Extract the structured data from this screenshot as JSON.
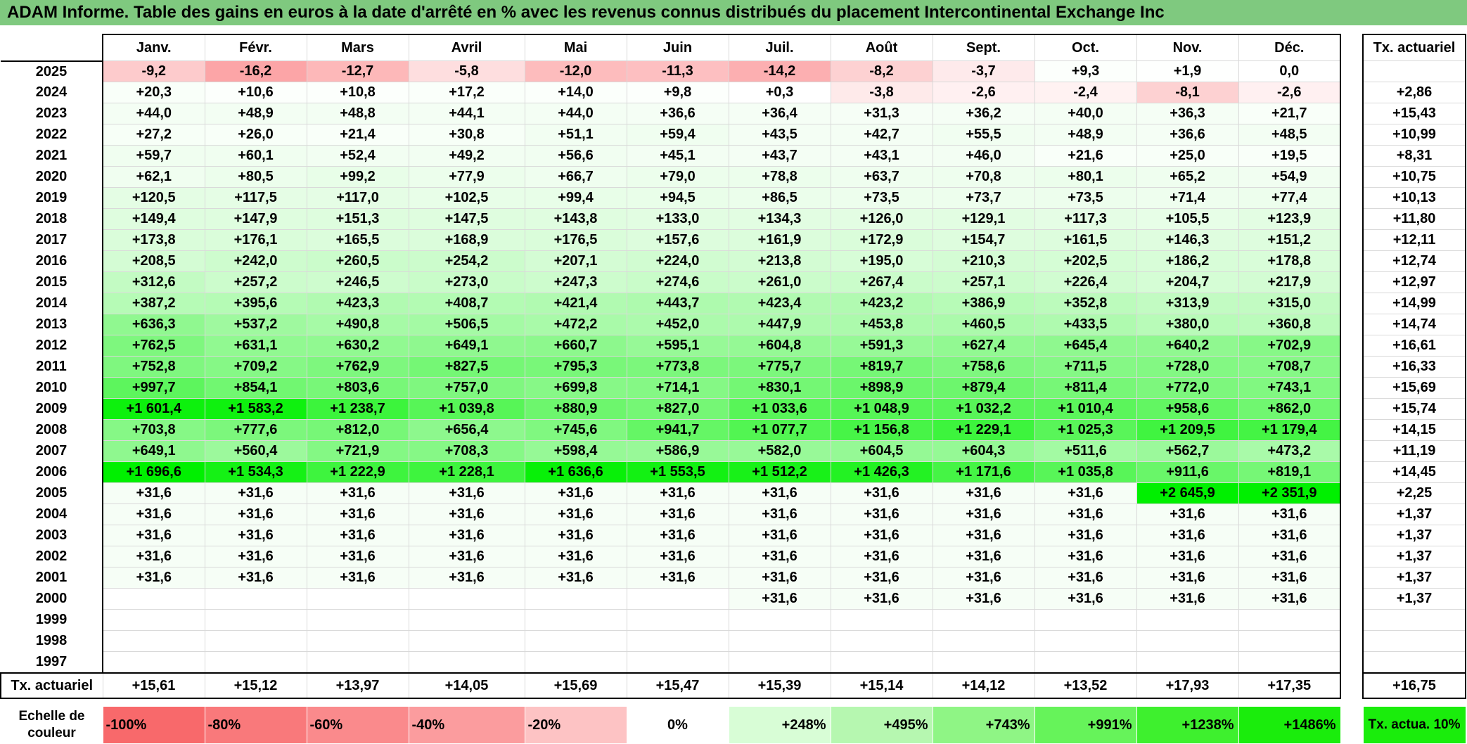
{
  "title": "ADAM Informe. Table des gains en euros à la date d'arrêté en % avec les revenus connus distribués du placement Intercontinental Exchange Inc",
  "months": [
    "Janv.",
    "Févr.",
    "Mars",
    "Avril",
    "Mai",
    "Juin",
    "Juil.",
    "Août",
    "Sept.",
    "Oct.",
    "Nov.",
    "Déc."
  ],
  "rate_header": "Tx. actuariel",
  "rows": [
    {
      "year": "2025",
      "values": [
        "-9,2",
        "-16,2",
        "-12,7",
        "-5,8",
        "-12,0",
        "-11,3",
        "-14,2",
        "-8,2",
        "-3,7",
        "+9,3",
        "+1,9",
        "0,0"
      ],
      "rate": ""
    },
    {
      "year": "2024",
      "values": [
        "+20,3",
        "+10,6",
        "+10,8",
        "+17,2",
        "+14,0",
        "+9,8",
        "+0,3",
        "-3,8",
        "-2,6",
        "-2,4",
        "-8,1",
        "-2,6"
      ],
      "rate": "+2,86"
    },
    {
      "year": "2023",
      "values": [
        "+44,0",
        "+48,9",
        "+48,8",
        "+44,1",
        "+44,0",
        "+36,6",
        "+36,4",
        "+31,3",
        "+36,2",
        "+40,0",
        "+36,3",
        "+21,7"
      ],
      "rate": "+15,43"
    },
    {
      "year": "2022",
      "values": [
        "+27,2",
        "+26,0",
        "+21,4",
        "+30,8",
        "+51,1",
        "+59,4",
        "+43,5",
        "+42,7",
        "+55,5",
        "+48,9",
        "+36,6",
        "+48,5"
      ],
      "rate": "+10,99"
    },
    {
      "year": "2021",
      "values": [
        "+59,7",
        "+60,1",
        "+52,4",
        "+49,2",
        "+56,6",
        "+45,1",
        "+43,7",
        "+43,1",
        "+46,0",
        "+21,6",
        "+25,0",
        "+19,5"
      ],
      "rate": "+8,31"
    },
    {
      "year": "2020",
      "values": [
        "+62,1",
        "+80,5",
        "+99,2",
        "+77,9",
        "+66,7",
        "+79,0",
        "+78,8",
        "+63,7",
        "+70,8",
        "+80,1",
        "+65,2",
        "+54,9"
      ],
      "rate": "+10,75"
    },
    {
      "year": "2019",
      "values": [
        "+120,5",
        "+117,5",
        "+117,0",
        "+102,5",
        "+99,4",
        "+94,5",
        "+86,5",
        "+73,5",
        "+73,7",
        "+73,5",
        "+71,4",
        "+77,4"
      ],
      "rate": "+10,13"
    },
    {
      "year": "2018",
      "values": [
        "+149,4",
        "+147,9",
        "+151,3",
        "+147,5",
        "+143,8",
        "+133,0",
        "+134,3",
        "+126,0",
        "+129,1",
        "+117,3",
        "+105,5",
        "+123,9"
      ],
      "rate": "+11,80"
    },
    {
      "year": "2017",
      "values": [
        "+173,8",
        "+176,1",
        "+165,5",
        "+168,9",
        "+176,5",
        "+157,6",
        "+161,9",
        "+172,9",
        "+154,7",
        "+161,5",
        "+146,3",
        "+151,2"
      ],
      "rate": "+12,11"
    },
    {
      "year": "2016",
      "values": [
        "+208,5",
        "+242,0",
        "+260,5",
        "+254,2",
        "+207,1",
        "+224,0",
        "+213,8",
        "+195,0",
        "+210,3",
        "+202,5",
        "+186,2",
        "+178,8"
      ],
      "rate": "+12,74"
    },
    {
      "year": "2015",
      "values": [
        "+312,6",
        "+257,2",
        "+246,5",
        "+273,0",
        "+247,3",
        "+274,6",
        "+261,0",
        "+267,4",
        "+257,1",
        "+226,4",
        "+204,7",
        "+217,9"
      ],
      "rate": "+12,97"
    },
    {
      "year": "2014",
      "values": [
        "+387,2",
        "+395,6",
        "+423,3",
        "+408,7",
        "+421,4",
        "+443,7",
        "+423,4",
        "+423,2",
        "+386,9",
        "+352,8",
        "+313,9",
        "+315,0"
      ],
      "rate": "+14,99"
    },
    {
      "year": "2013",
      "values": [
        "+636,3",
        "+537,2",
        "+490,8",
        "+506,5",
        "+472,2",
        "+452,0",
        "+447,9",
        "+453,8",
        "+460,5",
        "+433,5",
        "+380,0",
        "+360,8"
      ],
      "rate": "+14,74"
    },
    {
      "year": "2012",
      "values": [
        "+762,5",
        "+631,1",
        "+630,2",
        "+649,1",
        "+660,7",
        "+595,1",
        "+604,8",
        "+591,3",
        "+627,4",
        "+645,4",
        "+640,2",
        "+702,9"
      ],
      "rate": "+16,61"
    },
    {
      "year": "2011",
      "values": [
        "+752,8",
        "+709,2",
        "+762,9",
        "+827,5",
        "+795,3",
        "+773,8",
        "+775,7",
        "+819,7",
        "+758,6",
        "+711,5",
        "+728,0",
        "+708,7"
      ],
      "rate": "+16,33"
    },
    {
      "year": "2010",
      "values": [
        "+997,7",
        "+854,1",
        "+803,6",
        "+757,0",
        "+699,8",
        "+714,1",
        "+830,1",
        "+898,9",
        "+879,4",
        "+811,4",
        "+772,0",
        "+743,1"
      ],
      "rate": "+15,69"
    },
    {
      "year": "2009",
      "values": [
        "+1 601,4",
        "+1 583,2",
        "+1 238,7",
        "+1 039,8",
        "+880,9",
        "+827,0",
        "+1 033,6",
        "+1 048,9",
        "+1 032,2",
        "+1 010,4",
        "+958,6",
        "+862,0"
      ],
      "rate": "+15,74"
    },
    {
      "year": "2008",
      "values": [
        "+703,8",
        "+777,6",
        "+812,0",
        "+656,4",
        "+745,6",
        "+941,7",
        "+1 077,7",
        "+1 156,8",
        "+1 229,1",
        "+1 025,3",
        "+1 209,5",
        "+1 179,4"
      ],
      "rate": "+14,15"
    },
    {
      "year": "2007",
      "values": [
        "+649,1",
        "+560,4",
        "+721,9",
        "+708,3",
        "+598,4",
        "+586,9",
        "+582,0",
        "+604,5",
        "+604,3",
        "+511,6",
        "+562,7",
        "+473,2"
      ],
      "rate": "+11,19"
    },
    {
      "year": "2006",
      "values": [
        "+1 696,6",
        "+1 534,3",
        "+1 222,9",
        "+1 228,1",
        "+1 636,6",
        "+1 553,5",
        "+1 512,2",
        "+1 426,3",
        "+1 171,6",
        "+1 035,8",
        "+911,6",
        "+819,1"
      ],
      "rate": "+14,45"
    },
    {
      "year": "2005",
      "values": [
        "+31,6",
        "+31,6",
        "+31,6",
        "+31,6",
        "+31,6",
        "+31,6",
        "+31,6",
        "+31,6",
        "+31,6",
        "+31,6",
        "+2 645,9",
        "+2 351,9"
      ],
      "rate": "+2,25"
    },
    {
      "year": "2004",
      "values": [
        "+31,6",
        "+31,6",
        "+31,6",
        "+31,6",
        "+31,6",
        "+31,6",
        "+31,6",
        "+31,6",
        "+31,6",
        "+31,6",
        "+31,6",
        "+31,6"
      ],
      "rate": "+1,37"
    },
    {
      "year": "2003",
      "values": [
        "+31,6",
        "+31,6",
        "+31,6",
        "+31,6",
        "+31,6",
        "+31,6",
        "+31,6",
        "+31,6",
        "+31,6",
        "+31,6",
        "+31,6",
        "+31,6"
      ],
      "rate": "+1,37"
    },
    {
      "year": "2002",
      "values": [
        "+31,6",
        "+31,6",
        "+31,6",
        "+31,6",
        "+31,6",
        "+31,6",
        "+31,6",
        "+31,6",
        "+31,6",
        "+31,6",
        "+31,6",
        "+31,6"
      ],
      "rate": "+1,37"
    },
    {
      "year": "2001",
      "values": [
        "+31,6",
        "+31,6",
        "+31,6",
        "+31,6",
        "+31,6",
        "+31,6",
        "+31,6",
        "+31,6",
        "+31,6",
        "+31,6",
        "+31,6",
        "+31,6"
      ],
      "rate": "+1,37"
    },
    {
      "year": "2000",
      "values": [
        "",
        "",
        "",
        "",
        "",
        "",
        "+31,6",
        "+31,6",
        "+31,6",
        "+31,6",
        "+31,6",
        "+31,6"
      ],
      "rate": "+1,37"
    },
    {
      "year": "1999",
      "values": [
        "",
        "",
        "",
        "",
        "",
        "",
        "",
        "",
        "",
        "",
        "",
        ""
      ],
      "rate": ""
    },
    {
      "year": "1998",
      "values": [
        "",
        "",
        "",
        "",
        "",
        "",
        "",
        "",
        "",
        "",
        "",
        ""
      ],
      "rate": ""
    },
    {
      "year": "1997",
      "values": [
        "",
        "",
        "",
        "",
        "",
        "",
        "",
        "",
        "",
        "",
        "",
        ""
      ],
      "rate": ""
    }
  ],
  "footer": {
    "label": "Tx. actuariel",
    "values": [
      "+15,61",
      "+15,12",
      "+13,97",
      "+14,05",
      "+15,69",
      "+15,47",
      "+15,39",
      "+15,14",
      "+14,12",
      "+13,52",
      "+17,93",
      "+17,35"
    ],
    "total": "+16,75"
  },
  "scale": {
    "label": "Echelle de couleur",
    "items": [
      {
        "text": "-100%",
        "color": "#f8696b",
        "align": "left"
      },
      {
        "text": "-80%",
        "color": "#f9797b",
        "align": "left"
      },
      {
        "text": "-60%",
        "color": "#fa8a8c",
        "align": "left"
      },
      {
        "text": "-40%",
        "color": "#fb9c9e",
        "align": "left"
      },
      {
        "text": "-20%",
        "color": "#fdc3c4",
        "align": "left"
      },
      {
        "text": "0%",
        "color": "#ffffff",
        "align": "center"
      },
      {
        "text": "+248%",
        "color": "#d8fdd6",
        "align": "right"
      },
      {
        "text": "+495%",
        "color": "#b6f7b0",
        "align": "right"
      },
      {
        "text": "+743%",
        "color": "#8ff585",
        "align": "right"
      },
      {
        "text": "+991%",
        "color": "#66f35a",
        "align": "right"
      },
      {
        "text": "+1238%",
        "color": "#3ef02e",
        "align": "right"
      },
      {
        "text": "+1486%",
        "color": "#1aed0c",
        "align": "right"
      }
    ],
    "rate_label": "Tx. actua. 10%",
    "rate_color": "#1aed0c"
  },
  "colors": {
    "title_bar": "#7fc97f",
    "positive_max": "#00f000",
    "negative_max": "#f8696b"
  }
}
